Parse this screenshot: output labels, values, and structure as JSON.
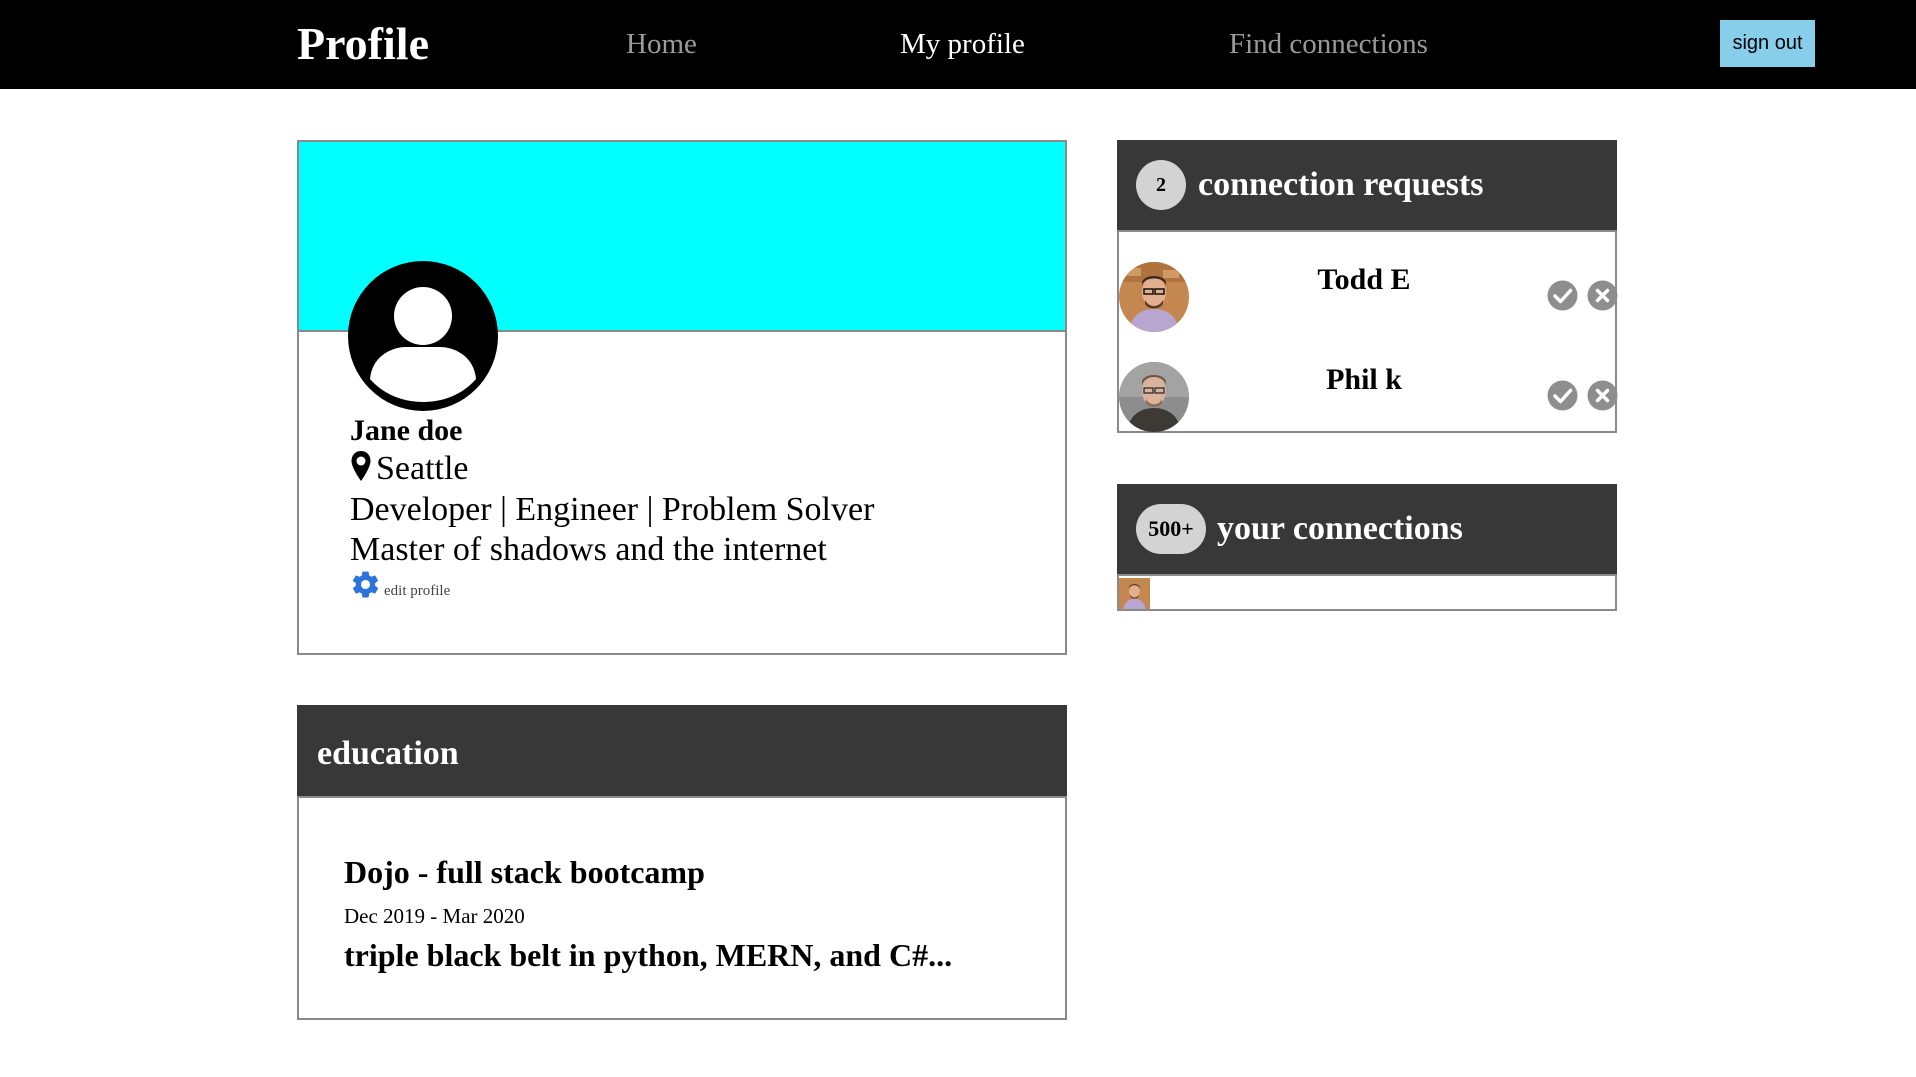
{
  "navbar": {
    "brand": "Profile",
    "links": [
      {
        "label": "Home",
        "active": false
      },
      {
        "label": "My profile",
        "active": true
      },
      {
        "label": "Find connections",
        "active": false
      }
    ],
    "sign_out_label": "sign out",
    "sign_out_color": "#87ceeb"
  },
  "profile": {
    "banner_color": "#00ffff",
    "avatar_icon": "user-silhouette-icon",
    "name": "Jane doe",
    "location_icon": "map-pin-icon",
    "location": "Seattle",
    "headline": "Developer | Engineer | Problem Solver",
    "bio": "Master of shadows and the internet",
    "edit_icon": "gear-icon",
    "edit_label": "edit profile"
  },
  "education": {
    "section_title": "education",
    "entries": [
      {
        "school": "Dojo - full stack bootcamp",
        "dates": "Dec 2019 - Mar 2020",
        "description": "triple black belt in python, MERN, and C#..."
      }
    ]
  },
  "connection_requests": {
    "count": "2",
    "title": "connection requests",
    "requests": [
      {
        "name": "Todd E",
        "accept_icon": "check-circle-icon",
        "reject_icon": "x-circle-icon"
      },
      {
        "name": "Phil k",
        "accept_icon": "check-circle-icon",
        "reject_icon": "x-circle-icon"
      }
    ]
  },
  "connections": {
    "count": "500+",
    "title": "your connections"
  },
  "colors": {
    "header_dark": "#383838",
    "border": "#8a8a8a",
    "action_gray": "#8e8e8e",
    "gear_blue": "#2e73d9"
  }
}
